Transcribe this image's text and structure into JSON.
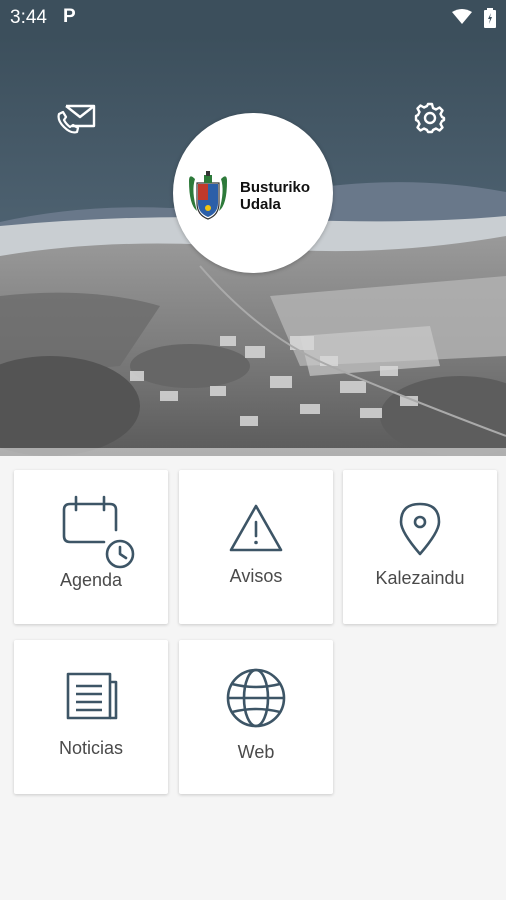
{
  "status_bar": {
    "time": "3:44",
    "notification": "P"
  },
  "header": {
    "mail_icon": "mail-phone-icon",
    "settings_icon": "gear-icon",
    "logo": {
      "line1": "Busturiko",
      "line2": "Udala"
    }
  },
  "tiles": [
    {
      "label": "Agenda",
      "icon": "calendar-clock-icon"
    },
    {
      "label": "Avisos",
      "icon": "warning-icon"
    },
    {
      "label": "Kalezaindu",
      "icon": "map-pin-icon"
    },
    {
      "label": "Noticias",
      "icon": "newspaper-icon"
    },
    {
      "label": "Web",
      "icon": "globe-icon"
    }
  ],
  "colors": {
    "primary": "#3c4f5c",
    "icon": "#3d5566",
    "background": "#f5f5f5"
  }
}
